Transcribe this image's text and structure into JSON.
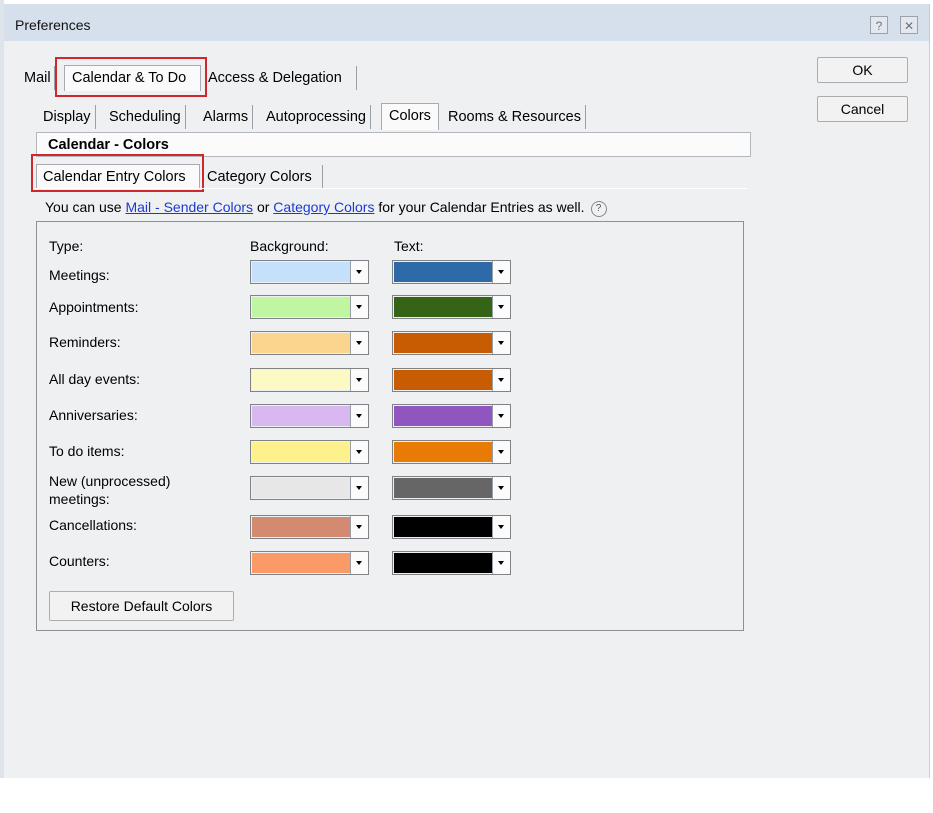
{
  "window": {
    "title": "Preferences",
    "help_glyph": "?",
    "close_glyph": "✕"
  },
  "main_tabs": [
    {
      "label": "Mail"
    },
    {
      "label": "Calendar & To Do"
    },
    {
      "label": "Access & Delegation"
    }
  ],
  "sub_tabs": [
    {
      "label": "Display"
    },
    {
      "label": "Scheduling"
    },
    {
      "label": "Alarms"
    },
    {
      "label": "Autoprocessing"
    },
    {
      "label": "Colors"
    },
    {
      "label": "Rooms & Resources"
    }
  ],
  "section_title": "Calendar - Colors",
  "color_tabs": [
    {
      "label": "Calendar Entry Colors"
    },
    {
      "label": "Category Colors"
    }
  ],
  "hint": {
    "prefix": "You can use ",
    "link1": "Mail - Sender Colors",
    "middle": " or ",
    "link2": "Category Colors",
    "suffix": " for your Calendar Entries as well.",
    "help_glyph": "?"
  },
  "columns": {
    "type": "Type:",
    "background": "Background:",
    "text": "Text:"
  },
  "rows": [
    {
      "label": "Meetings:",
      "bg": "#c5e0fa",
      "fg": "#2e6aa8"
    },
    {
      "label": "Appointments:",
      "bg": "#c0f5a2",
      "fg": "#356416"
    },
    {
      "label": "Reminders:",
      "bg": "#fbd48e",
      "fg": "#c85c03"
    },
    {
      "label": "All day events:",
      "bg": "#fdf9c4",
      "fg": "#c85c03"
    },
    {
      "label": "Anniversaries:",
      "bg": "#d9b8f2",
      "fg": "#9055be"
    },
    {
      "label": "To do items:",
      "bg": "#fcf18b",
      "fg": "#e77b06"
    },
    {
      "label": "New (unprocessed) meetings:",
      "bg": "#e7e7e7",
      "fg": "#666666"
    },
    {
      "label": "Cancellations:",
      "bg": "#d28a70",
      "fg": "#000000"
    },
    {
      "label": "Counters:",
      "bg": "#fb9a66",
      "fg": "#000000"
    }
  ],
  "restore_button": "Restore Default Colors",
  "ok_button": "OK",
  "cancel_button": "Cancel"
}
